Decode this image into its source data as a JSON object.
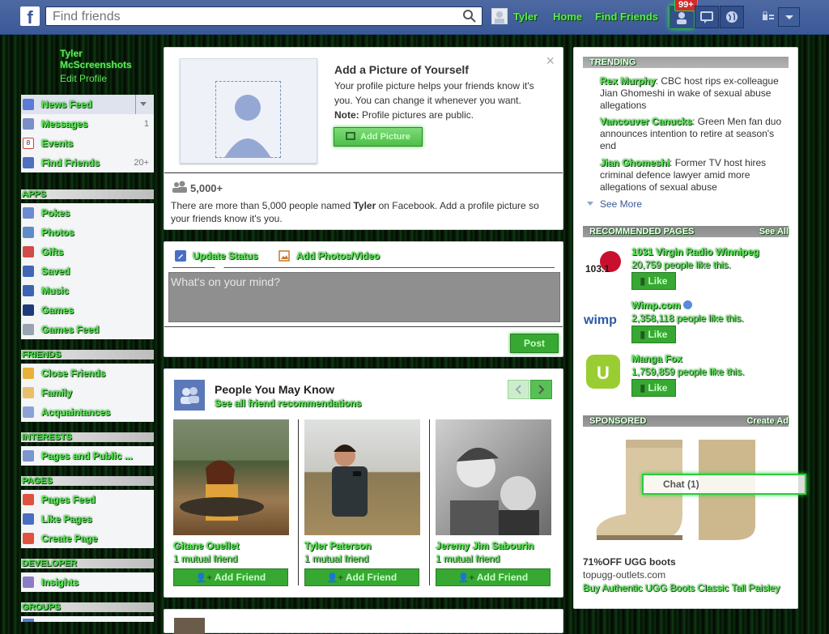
{
  "topbar": {
    "logo": "f",
    "search_placeholder": "Find friends",
    "user_name": "Tyler",
    "nav_home": "Home",
    "nav_find_friends": "Find Friends",
    "notif_count": "99+"
  },
  "left": {
    "profile_name_line1": "Tyler",
    "profile_name_line2": "McScreenshots",
    "edit_profile": "Edit Profile",
    "main_items": [
      {
        "label": "News Feed",
        "count": ""
      },
      {
        "label": "Messages",
        "count": "1"
      },
      {
        "label": "Events",
        "count": ""
      },
      {
        "label": "Find Friends",
        "count": "20+"
      }
    ],
    "apps_header": "APPS",
    "apps": [
      "Pokes",
      "Photos",
      "Gifts",
      "Saved",
      "Music",
      "Games",
      "Games Feed"
    ],
    "friends_header": "FRIENDS",
    "friends": [
      "Close Friends",
      "Family",
      "Acquaintances"
    ],
    "interests_header": "INTERESTS",
    "interests": [
      "Pages and Public ..."
    ],
    "pages_header": "PAGES",
    "pages": [
      "Pages Feed",
      "Like Pages",
      "Create Page"
    ],
    "developer_header": "DEVELOPER",
    "developer": [
      "Insights"
    ],
    "groups_header": "GROUPS"
  },
  "picture_card": {
    "title": "Add a Picture of Yourself",
    "body": "Your profile picture helps your friends know it's you. You can change it whenever you want.",
    "note_label": "Note:",
    "note_text": " Profile pictures are public.",
    "button": "Add Picture",
    "count": "5,000+",
    "info_pre": "There are more than 5,000 people named ",
    "info_name": "Tyler",
    "info_post": " on Facebook. Add a profile picture so your friends know it's you.",
    "close": "×"
  },
  "composer": {
    "update_status": "Update Status",
    "add_photos": "Add Photos/Video",
    "placeholder": "What's on your mind?",
    "post": "Post"
  },
  "pymk": {
    "title": "People You May Know",
    "subtitle": "See all friend recommendations",
    "people": [
      {
        "name": "Gitane Ouellet",
        "mutual": "1 mutual friend",
        "button": "Add Friend"
      },
      {
        "name": "Tyler Paterson",
        "mutual": "1 mutual friend",
        "button": "Add Friend"
      },
      {
        "name": "Jeremy Jim Sabourin",
        "mutual": "1 mutual friend",
        "button": "Add Friend"
      }
    ]
  },
  "trending": {
    "header": "TRENDING",
    "items": [
      {
        "topic": "Rex Murphy",
        "text": ": CBC host rips ex-colleague Jian Ghomeshi in wake of sexual abuse allegations"
      },
      {
        "topic": "Vancouver Canucks",
        "text": ": Green Men fan duo announces intention to retire at season's end"
      },
      {
        "topic": "Jian Ghomeshi",
        "text": ": Former TV host hires criminal defence lawyer amid more allegations of sexual abuse"
      }
    ],
    "see_more": "See More"
  },
  "recommended": {
    "header": "RECOMMENDED PAGES",
    "see_all": "See All",
    "pages": [
      {
        "name": "1031 Virgin Radio Winnipeg",
        "likes": "20,759 people like this.",
        "like": "Like",
        "logo_text": "103.1"
      },
      {
        "name": "Wimp.com",
        "likes": "2,358,118 people like this.",
        "like": "Like",
        "logo_text": "wimp"
      },
      {
        "name": "Manga Fox",
        "likes": "1,759,859 people like this.",
        "like": "Like",
        "logo_text": "U"
      }
    ]
  },
  "sponsored": {
    "header": "SPONSORED",
    "create_ad": "Create Ad",
    "ad_title": "71%OFF UGG boots",
    "ad_domain": "topugg-outlets.com",
    "ad_text": "Buy Authentic UGG Boots Classic Tall Paisley"
  },
  "chat": {
    "label": "Chat (1)"
  },
  "colors": {
    "facebook_blue": "#3b5998",
    "matrix_green": "#5fe85a"
  }
}
